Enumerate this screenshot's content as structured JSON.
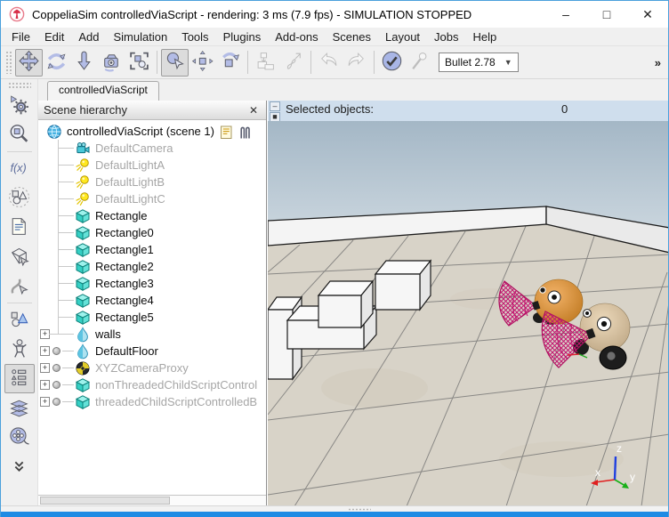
{
  "window": {
    "title": "CoppeliaSim controlledViaScript - rendering: 3 ms (7.9 fps) - SIMULATION STOPPED",
    "controls": {
      "minimize": "–",
      "maximize": "□",
      "close": "✕"
    }
  },
  "menu_bar": {
    "items": [
      "File",
      "Edit",
      "Add",
      "Simulation",
      "Tools",
      "Plugins",
      "Add-ons",
      "Scenes",
      "Layout",
      "Jobs",
      "Help"
    ]
  },
  "toolbar": {
    "buttons": [
      {
        "name": "camera-pan",
        "icon": "camera-pan-icon",
        "pressed": true
      },
      {
        "name": "camera-rotate",
        "icon": "camera-rotate-icon"
      },
      {
        "name": "camera-zoom",
        "icon": "camera-zoom-icon"
      },
      {
        "name": "camera-angle",
        "icon": "camera-shift-icon"
      },
      {
        "name": "fit-to-view",
        "icon": "fit-view-icon"
      },
      {
        "sep": true
      },
      {
        "name": "select",
        "icon": "select-icon",
        "pressed": true
      },
      {
        "name": "object-shift",
        "icon": "object-shift-icon"
      },
      {
        "name": "object-rotate",
        "icon": "object-rotate-icon"
      },
      {
        "sep": true
      },
      {
        "name": "assemble",
        "icon": "assemble-icon",
        "disabled": true
      },
      {
        "name": "transfer-dna",
        "icon": "transfer-dna-icon",
        "disabled": true
      },
      {
        "sep": true
      },
      {
        "name": "undo",
        "icon": "undo-icon",
        "disabled": true
      },
      {
        "name": "redo",
        "icon": "redo-icon",
        "disabled": true
      },
      {
        "sep": true
      },
      {
        "name": "toggle-dynamics",
        "icon": "dynamics-check-icon"
      },
      {
        "name": "visualize-dynamics",
        "icon": "pin-icon",
        "disabled": true
      }
    ],
    "engine_dropdown": {
      "value": "Bullet 2.78",
      "caret": "▼"
    },
    "overflow_label": "»"
  },
  "sidebar": {
    "buttons": [
      {
        "name": "simulation-settings",
        "icon": "gear-play-icon"
      },
      {
        "name": "scene-object-properties",
        "icon": "magnifier-cube-icon",
        "sep_after": true
      },
      {
        "name": "calculation-modules",
        "icon": "fx-icon",
        "glyph": "f(x)"
      },
      {
        "name": "collections",
        "icon": "collections-icon"
      },
      {
        "name": "scripts",
        "icon": "script-document-icon"
      },
      {
        "name": "shape-edit-mode",
        "icon": "cube-cursor-icon"
      },
      {
        "name": "path-edit-mode",
        "icon": "path-cursor-icon",
        "sep_after": true
      },
      {
        "name": "selection-tools",
        "icon": "primitives-icon"
      },
      {
        "name": "model-browser",
        "icon": "robot-icon"
      },
      {
        "name": "scene-hierarchy",
        "icon": "hierarchy-list-icon",
        "pressed": true
      },
      {
        "name": "page-selector",
        "icon": "layers-icon"
      },
      {
        "name": "video-recorder",
        "icon": "film-reel-icon"
      },
      {
        "name": "more-buttons",
        "icon": "double-chevron-down-icon"
      }
    ]
  },
  "tabs": {
    "active": "controlledViaScript"
  },
  "hierarchy": {
    "header": {
      "title": "Scene hierarchy",
      "close_glyph": "✕"
    },
    "expander_glyph": "+",
    "root": {
      "label": "controlledViaScript (scene 1)",
      "icon": "world-icon"
    },
    "items": [
      {
        "label": "DefaultCamera",
        "icon": "camera",
        "grayed": true
      },
      {
        "label": "DefaultLightA",
        "icon": "light",
        "grayed": true
      },
      {
        "label": "DefaultLightB",
        "icon": "light",
        "grayed": true
      },
      {
        "label": "DefaultLightC",
        "icon": "light",
        "grayed": true
      },
      {
        "label": "Rectangle",
        "icon": "cube"
      },
      {
        "label": "Rectangle0",
        "icon": "cube"
      },
      {
        "label": "Rectangle1",
        "icon": "cube"
      },
      {
        "label": "Rectangle2",
        "icon": "cube"
      },
      {
        "label": "Rectangle3",
        "icon": "cube"
      },
      {
        "label": "Rectangle4",
        "icon": "cube"
      },
      {
        "label": "Rectangle5",
        "icon": "cube"
      },
      {
        "label": "walls",
        "icon": "shape",
        "expander": true
      },
      {
        "label": "DefaultFloor",
        "icon": "shape",
        "expander": true,
        "dot": true
      },
      {
        "label": "XYZCameraProxy",
        "icon": "proxy",
        "expander": true,
        "dot": true,
        "grayed": true
      },
      {
        "label": "nonThreadedChildScriptControl",
        "icon": "cube",
        "expander": true,
        "dot": true,
        "grayed": true
      },
      {
        "label": "threadedChildScriptControlledB",
        "icon": "cube",
        "expander": true,
        "dot": true,
        "grayed": true
      }
    ]
  },
  "viewport": {
    "info_bar": {
      "label": "Selected objects:",
      "value": "0"
    },
    "axis_labels": {
      "x": "x",
      "y": "y",
      "z": "z"
    },
    "colors": {
      "sky_top": "#a4b7c6",
      "sky_bottom": "#d2dce3",
      "floor": "#d8d3c8",
      "grid_line": "#6f6f6f",
      "wall": "#f4f4f4",
      "box": "#f6f6f6",
      "robot_orange": "#e09a4a",
      "robot_beige": "#ddc7a6",
      "sensor_cone": "#c2156f",
      "wheel": "#1d1d1d"
    }
  }
}
